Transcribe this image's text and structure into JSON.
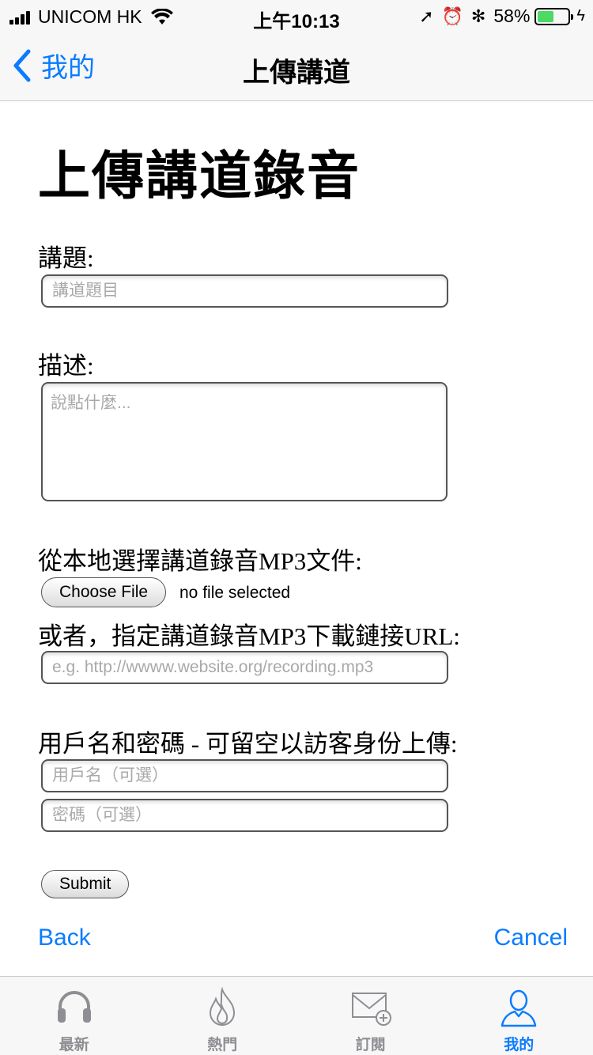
{
  "status_bar": {
    "carrier": "UNICOM HK",
    "time": "上午10:13",
    "battery_percent": "58%",
    "battery_level": 0.58,
    "battery_color": "#4cd964"
  },
  "nav": {
    "back_label": "我的",
    "title": "上傳講道"
  },
  "form": {
    "heading": "上傳講道錄音",
    "title_label": "講題:",
    "title_placeholder": "講道題目",
    "title_value": "",
    "description_label": "描述:",
    "description_placeholder": "說點什麼...",
    "description_value": "",
    "file_label": "從本地選擇講道錄音MP3文件:",
    "choose_file_button": "Choose File",
    "file_status": "no file selected",
    "url_label": "或者，指定講道錄音MP3下載鏈接URL:",
    "url_placeholder": "e.g. http://wwww.website.org/recording.mp3",
    "url_value": "",
    "credentials_label": "用戶名和密碼 - 可留空以訪客身份上傳:",
    "username_placeholder": "用戶名（可選）",
    "password_placeholder": "密碼（可選）",
    "submit_button": "Submit"
  },
  "footer": {
    "back_link": "Back",
    "cancel_link": "Cancel"
  },
  "tab_bar": {
    "active_index": 3,
    "tabs": [
      {
        "label": "最新",
        "icon": "headphones-icon"
      },
      {
        "label": "熱門",
        "icon": "flame-icon"
      },
      {
        "label": "訂閱",
        "icon": "mail-add-icon"
      },
      {
        "label": "我的",
        "icon": "user-icon"
      }
    ]
  },
  "colors": {
    "accent": "#0a7cff",
    "inactive": "#8e8e93"
  }
}
